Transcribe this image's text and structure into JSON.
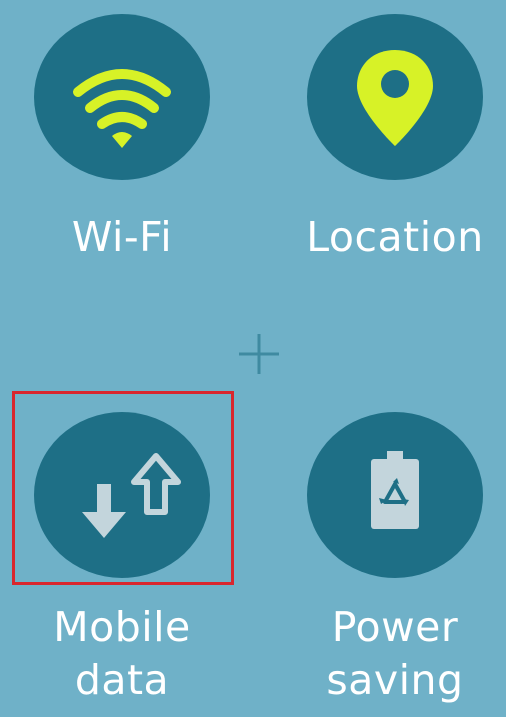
{
  "tiles": {
    "wifi": {
      "label": "Wi-Fi",
      "icon": "wifi-icon",
      "active": true
    },
    "location": {
      "label": "Location",
      "icon": "location-pin-icon",
      "active": true
    },
    "mobile_data": {
      "label_line1": "Mobile",
      "label_line2": "data",
      "icon": "mobile-data-arrows-icon",
      "active": false,
      "highlighted": true
    },
    "power_saving": {
      "label_line1": "Power",
      "label_line2": "saving",
      "icon": "battery-recycle-icon",
      "active": false
    }
  },
  "add_icon": "plus-icon",
  "colors": {
    "background": "#6fb1c8",
    "circle": "#1e6f86",
    "active_icon": "#d7f227",
    "inactive_icon": "#c3d5dc",
    "highlight_border": "#d8262e"
  }
}
